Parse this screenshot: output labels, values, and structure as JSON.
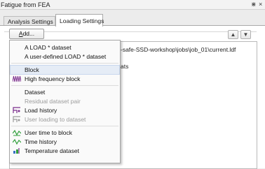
{
  "window": {
    "title": "Fatigue from FEA",
    "pin_glyph": "⋇",
    "close_glyph": "×"
  },
  "tabs": [
    {
      "label": "Analysis Settings",
      "active": false
    },
    {
      "label": "Loading Settings",
      "active": true
    }
  ],
  "toolbar": {
    "add_label_accel": "A",
    "add_label_rest": "dd...",
    "move_up_glyph": "▲",
    "move_down_glyph": "▼"
  },
  "list": {
    "path_fragment": "-safe-SSD-workshop\\jobs\\job_01\\current.ldf",
    "partial_text": "ats"
  },
  "menu": {
    "items": [
      {
        "label": "A LOAD * dataset",
        "enabled": true,
        "icon": null
      },
      {
        "label": "A user-defined LOAD * dataset",
        "enabled": true,
        "icon": null
      },
      {
        "label": "Block",
        "enabled": true,
        "icon": null,
        "highlighted": true
      },
      {
        "label": "High frequency block",
        "enabled": true,
        "icon": "high-frequency-icon"
      },
      {
        "label": "Dataset",
        "enabled": true,
        "icon": null
      },
      {
        "label": "Residual dataset pair",
        "enabled": false,
        "icon": null
      },
      {
        "label": "Load history",
        "enabled": true,
        "icon": "load-history-icon"
      },
      {
        "label": "User loading to dataset",
        "enabled": false,
        "icon": "user-loading-icon"
      },
      {
        "label": "User time to block",
        "enabled": true,
        "icon": "time-to-block-icon"
      },
      {
        "label": "Time history",
        "enabled": true,
        "icon": "time-history-icon"
      },
      {
        "label": "Temperature dataset",
        "enabled": true,
        "icon": "temperature-icon"
      }
    ]
  },
  "colors": {
    "highlight": "#e5ecf6",
    "disabled_text": "#9c9c9c",
    "icon_purple": "#7a2c8c",
    "icon_green": "#2f9e3a",
    "icon_blue": "#3a6fc4"
  }
}
